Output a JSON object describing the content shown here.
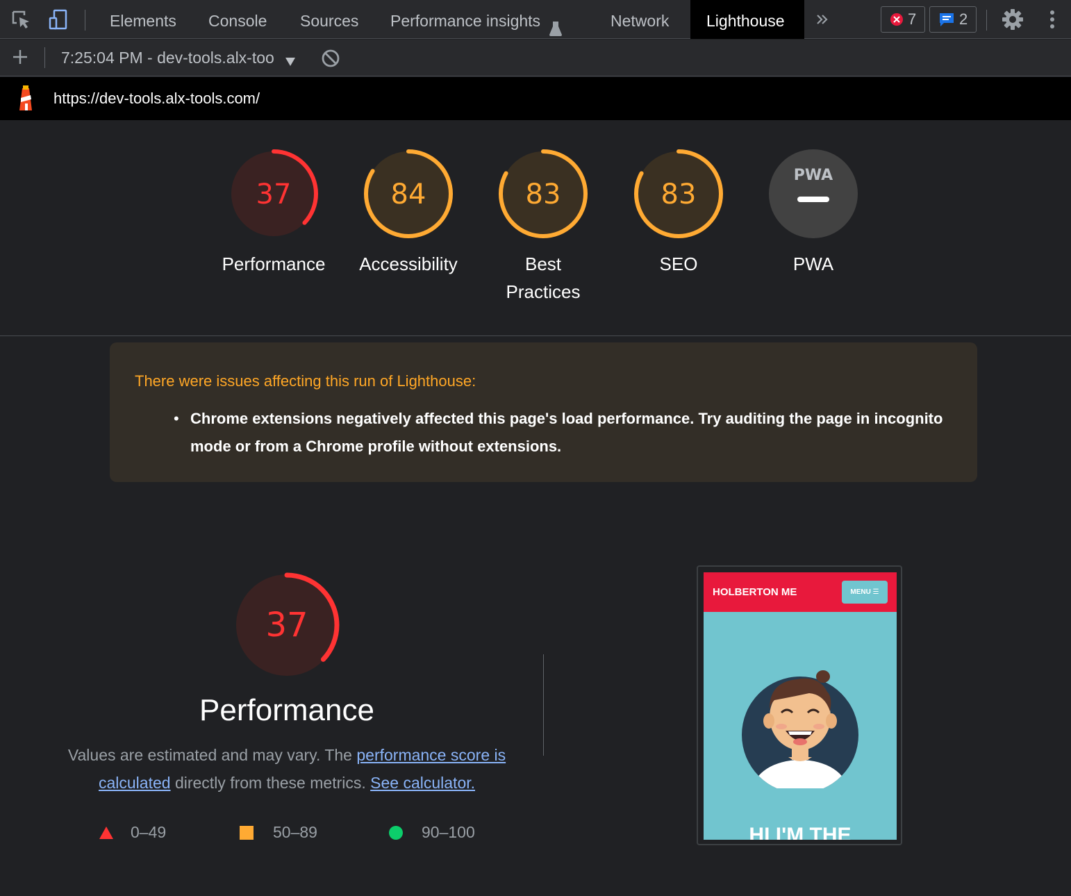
{
  "toolbar": {
    "tabs": [
      "Elements",
      "Console",
      "Sources",
      "Performance insights",
      "Network",
      "Lighthouse"
    ],
    "errors_count": "7",
    "messages_count": "2"
  },
  "report_bar": {
    "report_label": "7:25:04 PM - dev-tools.alx-too"
  },
  "url": "https://dev-tools.alx-tools.com/",
  "scores": [
    {
      "label": "Performance",
      "value": "37",
      "fraction": 0.37,
      "color": "#ff3333",
      "bg": "#3a2222"
    },
    {
      "label": "Accessibility",
      "value": "84",
      "fraction": 0.84,
      "color": "#ffaa33",
      "bg": "#3a3022"
    },
    {
      "label": "Best Practices",
      "value": "83",
      "fraction": 0.83,
      "color": "#ffaa33",
      "bg": "#3a3022"
    },
    {
      "label": "SEO",
      "value": "83",
      "fraction": 0.83,
      "color": "#ffaa33",
      "bg": "#3a3022"
    },
    {
      "label": "PWA",
      "value": "PWA",
      "color": "#ffffff",
      "bg": "#424242"
    }
  ],
  "warning": {
    "title": "There were issues affecting this run of Lighthouse:",
    "items": [
      "Chrome extensions negatively affected this page's load performance. Try auditing the page in incognito mode or from a Chrome profile without extensions."
    ]
  },
  "performance": {
    "score": "37",
    "fraction": 0.37,
    "title": "Performance",
    "desc_prefix": "Values are estimated and may vary. The ",
    "link_score": "performance score is calculated",
    "desc_mid": " directly from these metrics. ",
    "link_calc": "See calculator."
  },
  "legend": [
    {
      "range": "0–49",
      "shape": "triangle",
      "color": "#ff3333"
    },
    {
      "range": "50–89",
      "shape": "square",
      "color": "#ffaa33"
    },
    {
      "range": "90–100",
      "shape": "circle",
      "color": "#0cce6b"
    }
  ],
  "screenshot": {
    "brand": "HOLBERTON ME",
    "menu": "MENU ☰",
    "headline": "HI I'M THE"
  }
}
